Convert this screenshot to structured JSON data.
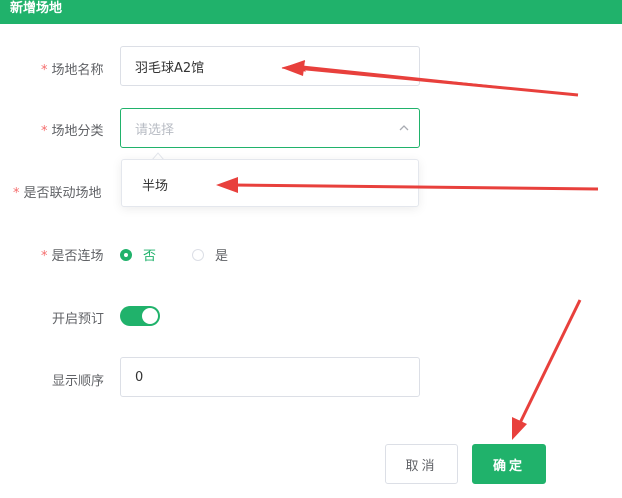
{
  "dialog": {
    "title": "新增场地"
  },
  "form": {
    "required_mark": "*",
    "name": {
      "label": "场地名称",
      "value": "羽毛球A2馆"
    },
    "category": {
      "label": "场地分类",
      "placeholder": "请选择",
      "options": [
        "半场"
      ]
    },
    "linked": {
      "label": "是否联动场地"
    },
    "consecutive": {
      "label": "是否连场",
      "options": [
        {
          "label": "否",
          "checked": true
        },
        {
          "label": "是",
          "checked": false
        }
      ]
    },
    "booking": {
      "label": "开启预订",
      "enabled": true
    },
    "order": {
      "label": "显示顺序",
      "value": "0"
    }
  },
  "footer": {
    "cancel_label": "取消",
    "confirm_label": "确定"
  },
  "colors": {
    "primary": "#20b26b",
    "required": "#f56c6c",
    "annotation_arrow": "#e8403c"
  },
  "icons": {
    "select_toggle": "chevron-up-icon",
    "annotation": "red-arrow-icon"
  }
}
